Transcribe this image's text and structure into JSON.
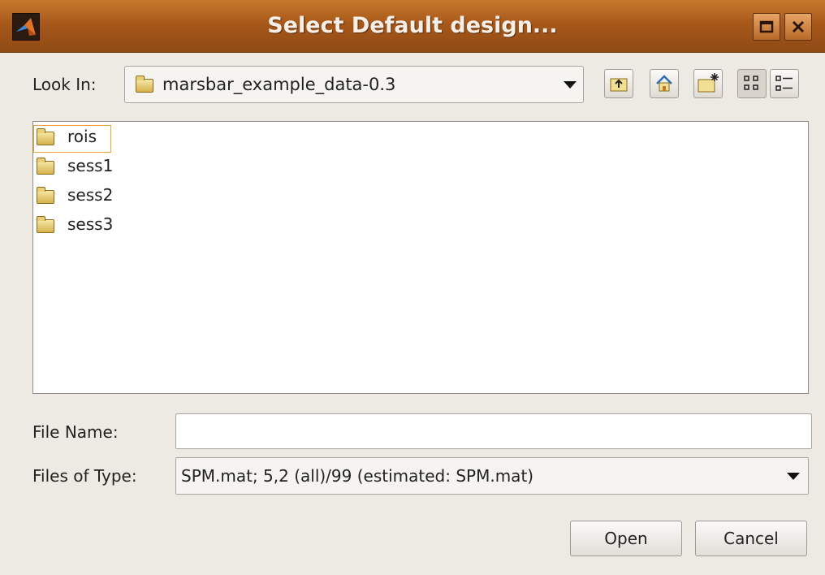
{
  "window": {
    "title": "Select Default design..."
  },
  "look_in": {
    "label": "Look In:",
    "value": "marsbar_example_data-0.3"
  },
  "toolbar": {
    "icons": [
      "up-folder-icon",
      "home-icon",
      "new-folder-icon",
      "list-view-icon",
      "details-view-icon"
    ]
  },
  "files": [
    {
      "name": "rois",
      "selected": true
    },
    {
      "name": "sess1",
      "selected": false
    },
    {
      "name": "sess2",
      "selected": false
    },
    {
      "name": "sess3",
      "selected": false
    }
  ],
  "file_name": {
    "label": "File Name:",
    "value": ""
  },
  "file_type": {
    "label": "Files of Type:",
    "value": "SPM.mat; 5,2 (all)/99 (estimated: SPM.mat)"
  },
  "buttons": {
    "open": "Open",
    "cancel": "Cancel"
  }
}
